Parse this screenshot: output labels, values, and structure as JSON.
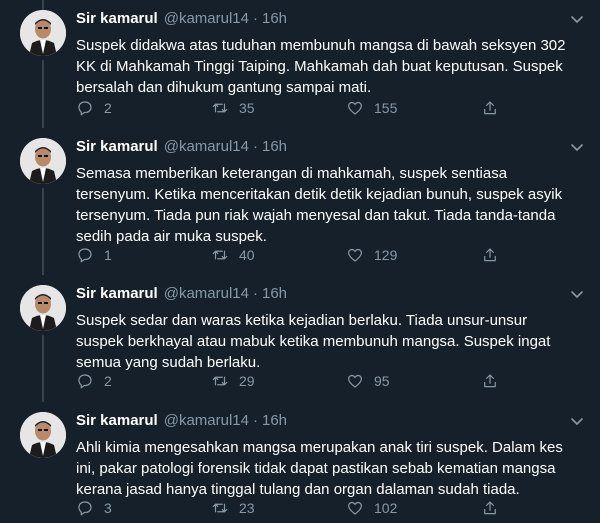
{
  "colors": {
    "background": "#15202b",
    "text_primary": "#ffffff",
    "text_secondary": "#8899a6",
    "divider": "#38444d"
  },
  "tweets": [
    {
      "name": "Sir kamarul",
      "handle": "@kamarul14",
      "separator": "·",
      "time": "16h",
      "lines": [
        "Suspek didakwa atas tuduhan membunuh mangsa di bawah seksyen 302",
        "KK di Mahkamah Tinggi Taiping. Mahkamah dah buat keputusan. Suspek",
        "bersalah dan dihukum gantung sampai mati."
      ],
      "replies": "2",
      "retweets": "35",
      "likes": "155"
    },
    {
      "name": "Sir kamarul",
      "handle": "@kamarul14",
      "separator": "·",
      "time": "16h",
      "lines": [
        "Semasa memberikan keterangan di mahkamah, suspek sentiasa",
        "tersenyum. Ketika menceritakan detik detik kejadian bunuh, suspek asyik",
        "tersenyum. Tiada pun riak wajah menyesal dan takut. Tiada tanda-tanda",
        "sedih pada air muka suspek."
      ],
      "replies": "1",
      "retweets": "40",
      "likes": "129"
    },
    {
      "name": "Sir kamarul",
      "handle": "@kamarul14",
      "separator": "·",
      "time": "16h",
      "lines": [
        "Suspek sedar dan waras ketika kejadian berlaku. Tiada unsur-unsur",
        "suspek berkhayal atau mabuk ketika membunuh mangsa. Suspek ingat",
        "semua yang sudah berlaku."
      ],
      "replies": "2",
      "retweets": "29",
      "likes": "95"
    },
    {
      "name": "Sir kamarul",
      "handle": "@kamarul14",
      "separator": "·",
      "time": "16h",
      "lines": [
        "Ahli kimia mengesahkan mangsa merupakan anak tiri suspek. Dalam kes",
        "ini, pakar patologi forensik tidak dapat pastikan sebab kematian mangsa",
        "kerana jasad hanya tinggal tulang dan organ dalaman sudah tiada."
      ],
      "replies": "3",
      "retweets": "23",
      "likes": "102"
    }
  ],
  "icons": {
    "reply": "reply-icon",
    "retweet": "retweet-icon",
    "like": "like-icon",
    "share": "share-icon",
    "more": "chevron-down-icon"
  }
}
